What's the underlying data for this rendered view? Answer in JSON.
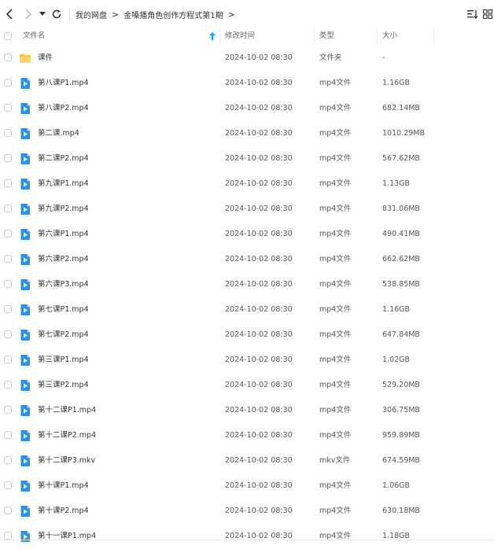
{
  "breadcrumb": {
    "root": "我的网盘",
    "current": "金嗓播角色创作方程式第1期"
  },
  "columns": {
    "name": "文件名",
    "modified": "修改时间",
    "type": "类型",
    "size": "大小"
  },
  "files": [
    {
      "name": "课件",
      "modified": "2024-10-02 08:30",
      "type": "文件夹",
      "size": "-",
      "icon": "folder-icon"
    },
    {
      "name": "第八课P1.mp4",
      "modified": "2024-10-02 08:30",
      "type": "mp4文件",
      "size": "1.16GB",
      "icon": "video-file-icon"
    },
    {
      "name": "第八课P2.mp4",
      "modified": "2024-10-02 08:30",
      "type": "mp4文件",
      "size": "682.14MB",
      "icon": "video-file-icon"
    },
    {
      "name": "第二课.mp4",
      "modified": "2024-10-02 08:30",
      "type": "mp4文件",
      "size": "1010.29MB",
      "icon": "video-file-icon"
    },
    {
      "name": "第二课P2.mp4",
      "modified": "2024-10-02 08:30",
      "type": "mp4文件",
      "size": "567.62MB",
      "icon": "video-file-icon"
    },
    {
      "name": "第九课P1.mp4",
      "modified": "2024-10-02 08:30",
      "type": "mp4文件",
      "size": "1.13GB",
      "icon": "video-file-icon"
    },
    {
      "name": "第九课P2.mp4",
      "modified": "2024-10-02 08:30",
      "type": "mp4文件",
      "size": "831.06MB",
      "icon": "video-file-icon"
    },
    {
      "name": "第六课P1.mp4",
      "modified": "2024-10-02 08:30",
      "type": "mp4文件",
      "size": "490.41MB",
      "icon": "video-file-icon"
    },
    {
      "name": "第六课P2.mp4",
      "modified": "2024-10-02 08:30",
      "type": "mp4文件",
      "size": "662.62MB",
      "icon": "video-file-icon"
    },
    {
      "name": "第六课P3.mp4",
      "modified": "2024-10-02 08:30",
      "type": "mp4文件",
      "size": "538.85MB",
      "icon": "video-file-icon"
    },
    {
      "name": "第七课P1.mp4",
      "modified": "2024-10-02 08:30",
      "type": "mp4文件",
      "size": "1.16GB",
      "icon": "video-file-icon"
    },
    {
      "name": "第七课P2.mp4",
      "modified": "2024-10-02 08:30",
      "type": "mp4文件",
      "size": "647.84MB",
      "icon": "video-file-icon"
    },
    {
      "name": "第三课P1.mp4",
      "modified": "2024-10-02 08:30",
      "type": "mp4文件",
      "size": "1.02GB",
      "icon": "video-file-icon"
    },
    {
      "name": "第三课P2.mp4",
      "modified": "2024-10-02 08:30",
      "type": "mp4文件",
      "size": "529.20MB",
      "icon": "video-file-icon"
    },
    {
      "name": "第十二课P1.mp4",
      "modified": "2024-10-02 08:30",
      "type": "mp4文件",
      "size": "306.75MB",
      "icon": "video-file-icon"
    },
    {
      "name": "第十二课P2.mp4",
      "modified": "2024-10-02 08:30",
      "type": "mp4文件",
      "size": "959.89MB",
      "icon": "video-file-icon"
    },
    {
      "name": "第十二课P3.mkv",
      "modified": "2024-10-02 08:30",
      "type": "mkv文件",
      "size": "674.59MB",
      "icon": "video-file-icon"
    },
    {
      "name": "第十课P1.mp4",
      "modified": "2024-10-02 08:30",
      "type": "mp4文件",
      "size": "1.06GB",
      "icon": "video-file-icon"
    },
    {
      "name": "第十课P2.mp4",
      "modified": "2024-10-02 08:30",
      "type": "mp4文件",
      "size": "630.18MB",
      "icon": "video-file-icon"
    },
    {
      "name": "第十一课P1.mp4",
      "modified": "2024-10-02 08:30",
      "type": "mp4文件",
      "size": "1.18GB",
      "icon": "video-file-icon"
    }
  ],
  "colors": {
    "accent": "#06a7ff",
    "folder": "#ffc53d",
    "video": "#2196f3"
  }
}
